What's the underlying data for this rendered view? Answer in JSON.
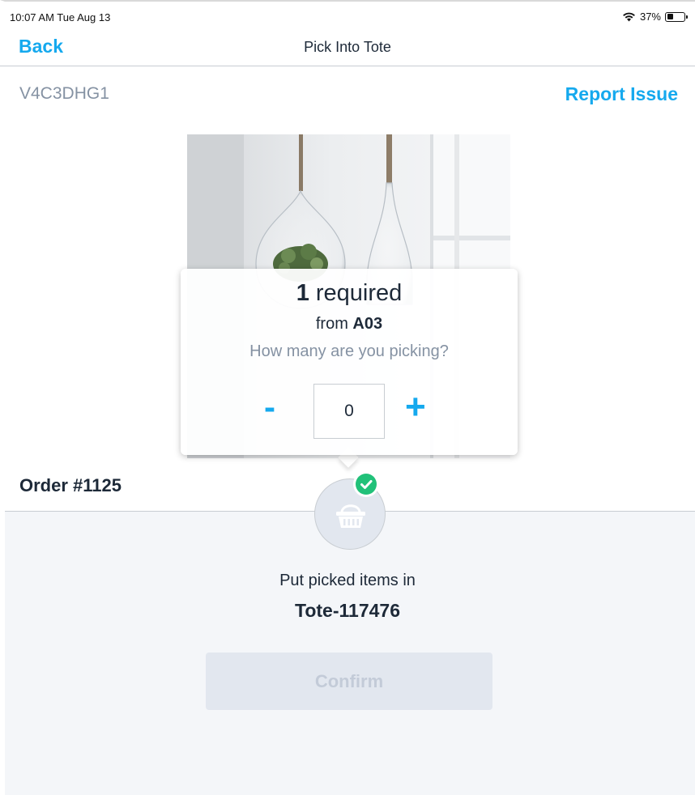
{
  "status_bar": {
    "time": "10:07 AM  Tue Aug 13",
    "battery_text": "37%",
    "battery_level": 0.37,
    "icons": [
      "wifi-icon",
      "battery-icon"
    ]
  },
  "nav": {
    "back_label": "Back",
    "title": "Pick Into Tote"
  },
  "item": {
    "sku": "V4C3DHG1",
    "report_issue_label": "Report Issue",
    "image_icon": "product-photo"
  },
  "picker": {
    "required_count": "1",
    "required_label": " required",
    "from_label": "from ",
    "location": "A03",
    "question": "How many are you picking?",
    "minus_label": "-",
    "quantity": "0",
    "plus_label": "+"
  },
  "order": {
    "number": "Order #1125"
  },
  "tote": {
    "icon": "basket-icon",
    "status_icon": "check-icon",
    "put_label": "Put picked items in",
    "tote_id": "Tote-117476",
    "confirm_label": "Confirm"
  },
  "colors": {
    "accent": "#15a9ee",
    "text_dark": "#1d2938",
    "text_muted": "#8592a3",
    "success": "#21c179",
    "panel_bg": "#f4f6f9",
    "disabled_bg": "#e2e7ef"
  }
}
